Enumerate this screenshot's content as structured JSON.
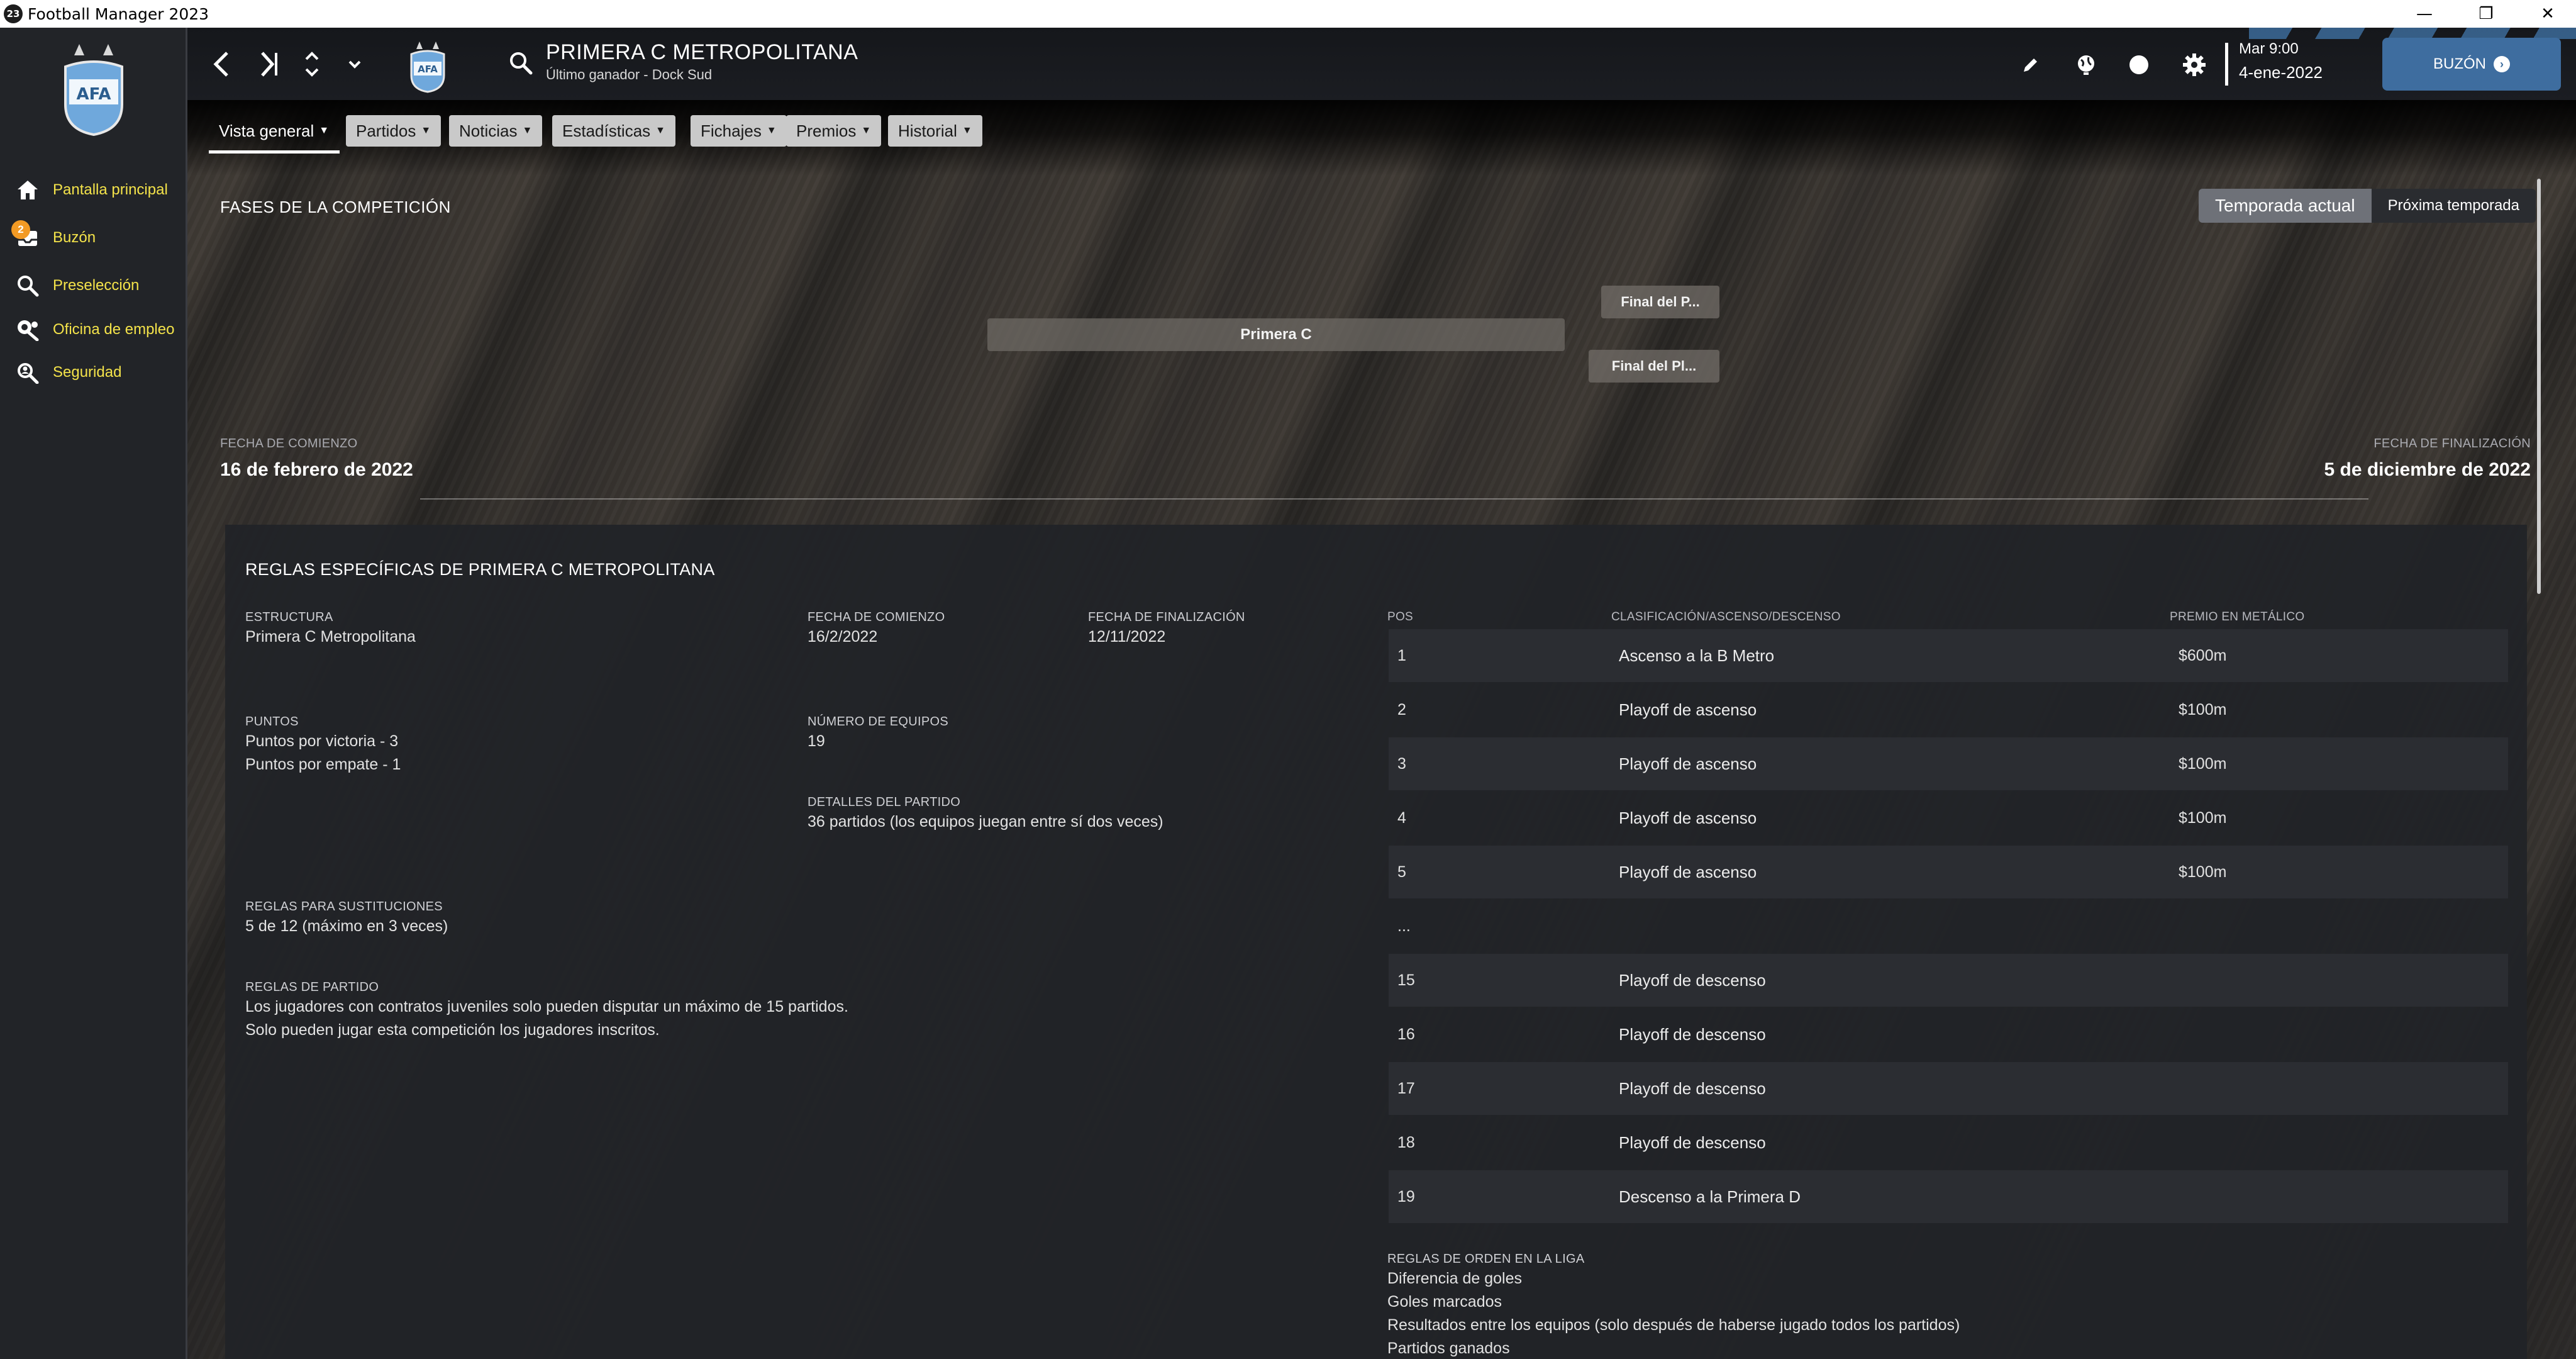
{
  "window": {
    "app_icon_text": "23",
    "title": "Football Manager 2023",
    "minimize": "—",
    "restore": "❐",
    "close": "✕"
  },
  "sidebar": {
    "items": [
      {
        "label": "Pantalla principal",
        "icon": "home-icon"
      },
      {
        "label": "Buzón",
        "icon": "inbox-icon",
        "badge": "2"
      },
      {
        "label": "Preselección",
        "icon": "search-icon"
      },
      {
        "label": "Oficina de empleo",
        "icon": "job-office-icon"
      },
      {
        "label": "Seguridad",
        "icon": "security-icon"
      }
    ]
  },
  "header": {
    "competition_title": "PRIMERA C METROPOLITANA",
    "subtitle": "Último ganador - Dock Sud",
    "time": "Mar 9:00",
    "date": "4-ene-2022",
    "inbox_button": "BUZÓN"
  },
  "tabs": [
    {
      "label": "Vista general",
      "active": true
    },
    {
      "label": "Partidos",
      "active": false
    },
    {
      "label": "Noticias",
      "active": false
    },
    {
      "label": "Estadísticas",
      "active": false
    },
    {
      "label": "Fichajes",
      "active": false
    },
    {
      "label": "Premios",
      "active": false
    },
    {
      "label": "Historial",
      "active": false
    }
  ],
  "stages": {
    "title": "FASES DE LA COMPETICIÓN",
    "season_current": "Temporada actual",
    "season_next": "Próxima temporada",
    "main_stage": "Primera C",
    "final_1": "Final del P...",
    "final_2": "Final del Pl...",
    "start_label": "FECHA DE COMIENZO",
    "start_value": "16 de febrero de 2022",
    "end_label": "FECHA DE FINALIZACIÓN",
    "end_value": "5 de diciembre de 2022"
  },
  "rules": {
    "title": "REGLAS ESPECÍFICAS DE PRIMERA C METROPOLITANA",
    "structure_label": "ESTRUCTURA",
    "structure_value": "Primera C Metropolitana",
    "start_label": "FECHA DE COMIENZO",
    "start_value": "16/2/2022",
    "end_label": "FECHA DE FINALIZACIÓN",
    "end_value": "12/11/2022",
    "points_label": "PUNTOS",
    "points_win": "Puntos por victoria - 3",
    "points_draw": "Puntos por empate - 1",
    "teams_label": "NÚMERO DE EQUIPOS",
    "teams_value": "19",
    "match_details_label": "DETALLES DEL PARTIDO",
    "match_details_value": "36 partidos (los equipos juegan entre sí dos veces)",
    "subs_label": "REGLAS PARA SUSTITUCIONES",
    "subs_value": "5 de 12 (máximo en 3 veces)",
    "match_rules_label": "REGLAS DE PARTIDO",
    "match_rules_1": "Los jugadores con contratos juveniles solo pueden disputar un máximo de 15 partidos.",
    "match_rules_2": "Solo pueden jugar esta competición los jugadores inscritos.",
    "table_headers": {
      "pos": "POS",
      "classification": "CLASIFICACIÓN/ASCENSO/DESCENSO",
      "prize": "PREMIO EN METÁLICO"
    },
    "table_rows": [
      {
        "pos": "1",
        "classification": "Ascenso a la B Metro",
        "prize": "$600m"
      },
      {
        "pos": "2",
        "classification": "Playoff de ascenso",
        "prize": "$100m"
      },
      {
        "pos": "3",
        "classification": "Playoff de ascenso",
        "prize": "$100m"
      },
      {
        "pos": "4",
        "classification": "Playoff de ascenso",
        "prize": "$100m"
      },
      {
        "pos": "5",
        "classification": "Playoff de ascenso",
        "prize": "$100m"
      },
      {
        "pos": "...",
        "classification": "",
        "prize": ""
      },
      {
        "pos": "15",
        "classification": "Playoff de descenso",
        "prize": ""
      },
      {
        "pos": "16",
        "classification": "Playoff de descenso",
        "prize": ""
      },
      {
        "pos": "17",
        "classification": "Playoff de descenso",
        "prize": ""
      },
      {
        "pos": "18",
        "classification": "Playoff de descenso",
        "prize": ""
      },
      {
        "pos": "19",
        "classification": "Descenso a la Primera D",
        "prize": ""
      }
    ],
    "order_label": "REGLAS DE ORDEN EN LA LIGA",
    "order_rules": [
      "Diferencia de goles",
      "Goles marcados",
      "Resultados entre los equipos (solo después de haberse jugado todos los partidos)",
      "Partidos ganados"
    ]
  },
  "colors": {
    "accent": "#3e6d9f",
    "sidebar_text": "#f4e34a",
    "badge": "#f29a24"
  }
}
